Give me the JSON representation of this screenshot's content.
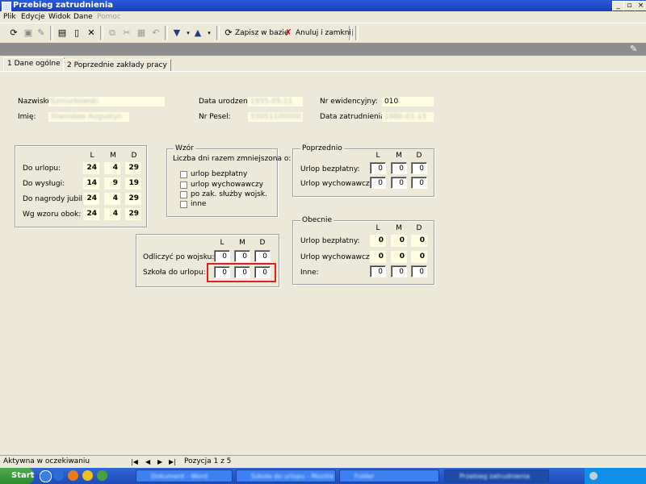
{
  "window": {
    "title": "Przebieg zatrudnienia"
  },
  "menu": [
    "Plik",
    "Edycje",
    "Widok",
    "Dane",
    "Pomoc"
  ],
  "toolbar": {
    "save_label": "Zapisz w bazie",
    "cancel_label": "Anuluj i zamknij"
  },
  "tabs": [
    {
      "label": "1 Dane ogólne"
    },
    {
      "label": "2 Poprzednie zakłady pracy"
    }
  ],
  "personal": {
    "nazwisko_label": "Nazwisko:",
    "nazwisko_value": "Szmurkowski",
    "imie_label": "Imię:",
    "imie_value": "Stanisław Augustyn",
    "data_urodzenia_label": "Data urodzenia:",
    "data_urodzenia_value": "1955-05-11",
    "pesel_label": "Nr Pesel:",
    "pesel_value": "55051100000",
    "nr_ewid_label": "Nr ewidencyjny:",
    "nr_ewid_value": "010",
    "data_zatr_label": "Data zatrudnienia:",
    "data_zatr_value": "1980-01-15"
  },
  "stats": {
    "cols": [
      "L",
      "M",
      "D"
    ],
    "rows": [
      {
        "label": "Do urlopu:",
        "values": [
          "24",
          "4",
          "29"
        ]
      },
      {
        "label": "Do wysługi:",
        "values": [
          "14",
          "9",
          "19"
        ]
      },
      {
        "label": "Do nagrody jubil.:",
        "values": [
          "24",
          "4",
          "29"
        ]
      },
      {
        "label": "Wg wzoru obok:",
        "values": [
          "24",
          "4",
          "29"
        ]
      }
    ]
  },
  "wzor": {
    "title": "Wzór",
    "subtitle": "Liczba dni razem zmniejszona o:",
    "options": [
      "urlop bezpłatny",
      "urlop wychowawczy",
      "po zak. służby wojsk.",
      "inne"
    ]
  },
  "poprzednio": {
    "title": "Poprzednio",
    "cols": [
      "L",
      "M",
      "D"
    ],
    "rows": [
      {
        "label": "Urlop bezpłatny:",
        "values": [
          "0",
          "0",
          "0"
        ]
      },
      {
        "label": "Urlop wychowawczy:",
        "values": [
          "0",
          "0",
          "0"
        ]
      }
    ]
  },
  "obecnie": {
    "title": "Obecnie",
    "cols": [
      "L",
      "M",
      "D"
    ],
    "rows": [
      {
        "label": "Urlop bezpłatny:",
        "values": [
          "0",
          "0",
          "0"
        ]
      },
      {
        "label": "Urlop wychowawczy:",
        "values": [
          "0",
          "0",
          "0"
        ]
      },
      {
        "label": "Inne:",
        "values": [
          "0",
          "0",
          "0"
        ]
      }
    ]
  },
  "odliczyc": {
    "cols": [
      "L",
      "M",
      "D"
    ],
    "rows": [
      {
        "label": "Odliczyć po wojsku:",
        "values": [
          "0",
          "0",
          "0"
        ]
      },
      {
        "label": "Szkoła do urlopu:",
        "values": [
          "0",
          "0",
          "0"
        ]
      }
    ]
  },
  "status": {
    "left": "Aktywna w oczekiwaniu",
    "position": "Pozycja 1 z 5"
  },
  "taskbar": {
    "start": "Start",
    "tasks": [
      "Dokument - Word",
      "Szkoła do urlopu - Mozilla",
      "Folder",
      "Przebieg zatrudnienia"
    ]
  }
}
